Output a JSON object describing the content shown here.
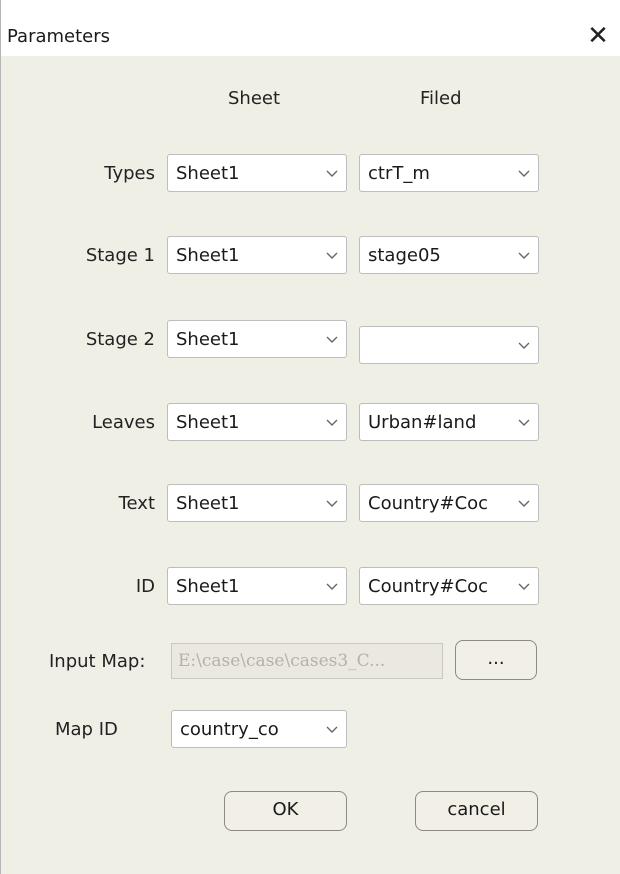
{
  "dialog": {
    "title": "Parameters",
    "close_glyph": "✕"
  },
  "headers": {
    "sheet": "Sheet",
    "field": "Filed"
  },
  "rows": [
    {
      "label": "Types",
      "sheet": "Sheet1",
      "field": "ctrT_m"
    },
    {
      "label": "Stage 1",
      "sheet": "Sheet1",
      "field": "stage05"
    },
    {
      "label": "Stage 2",
      "sheet": "Sheet1",
      "field": ""
    },
    {
      "label": "Leaves",
      "sheet": "Sheet1",
      "field": "Urban#land"
    },
    {
      "label": "Text",
      "sheet": "Sheet1",
      "field": "Country#Coc"
    },
    {
      "label": "ID",
      "sheet": "Sheet1",
      "field": "Country#Coc"
    }
  ],
  "input_map": {
    "label": "Input Map:",
    "value": "E:\\case\\case\\cases3_C...",
    "browse_label": "..."
  },
  "map_id": {
    "label": "Map ID",
    "value": "country_co"
  },
  "buttons": {
    "ok": "OK",
    "cancel": "cancel"
  },
  "icons": {
    "dropdown": "chevron-down-icon",
    "close": "close-icon"
  }
}
